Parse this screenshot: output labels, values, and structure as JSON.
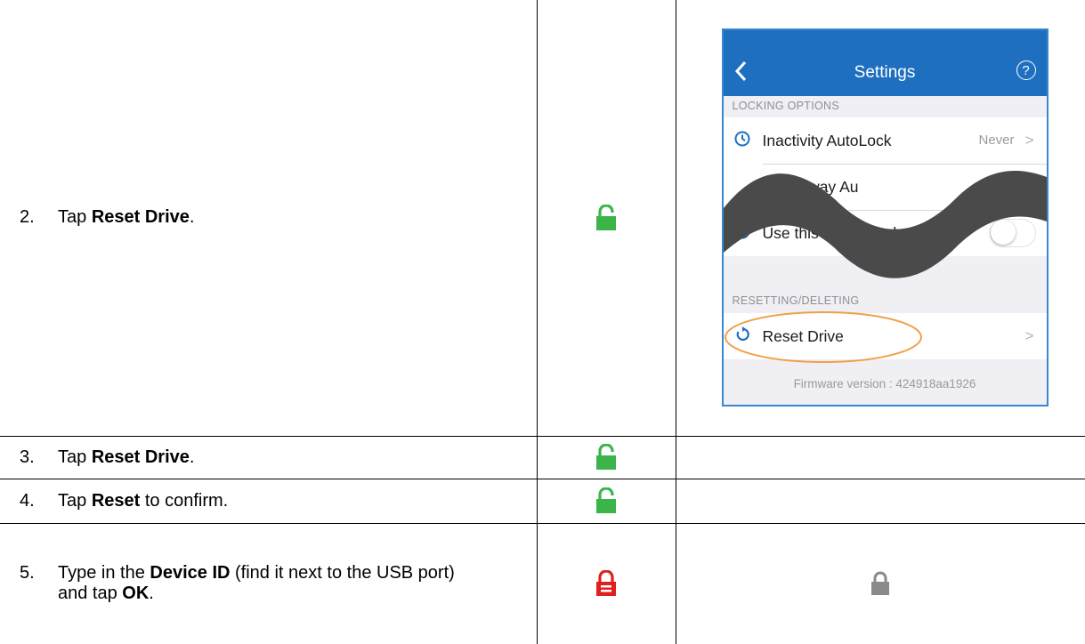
{
  "steps": [
    {
      "num": "2.",
      "pre": "Tap ",
      "bold": "Reset Drive",
      "post": ".",
      "lock": "unlocked-green"
    },
    {
      "num": "3.",
      "pre": "Tap ",
      "bold": "Reset Drive",
      "post": ".",
      "lock": "unlocked-green"
    },
    {
      "num": "4.",
      "pre": "Tap ",
      "bold": "Reset",
      "post": " to confirm.",
      "lock": "unlocked-green"
    },
    {
      "num": "5.",
      "pre": "Type in the ",
      "bold": "Device ID",
      "post": " (find it next to the USB port) and tap ",
      "bold2": "OK",
      "post2": ".",
      "lock": "locked-red",
      "status_lock": "locked-gray"
    }
  ],
  "phone": {
    "title": "Settings",
    "help_glyph": "?",
    "section_locking": "LOCKING OPTIONS",
    "row_autolock_label": "Inactivity AutoLock",
    "row_autolock_value": "Never",
    "row_stepaway_label": "Step-away Au",
    "row_stepaway_toggle": "on",
    "row_phoneonly_label": "Use this Phone Only",
    "row_phoneonly_toggle": "off",
    "section_reset": "RESETTING/DELETING",
    "row_reset_label": "Reset Drive",
    "footer": "Firmware version : 424918aa1926"
  },
  "colors": {
    "lock_green": "#3bb54a",
    "lock_red": "#e02020",
    "lock_gray": "#8a8a8a",
    "header_blue": "#1f6fc0",
    "highlight_orange": "#f0a04a"
  }
}
